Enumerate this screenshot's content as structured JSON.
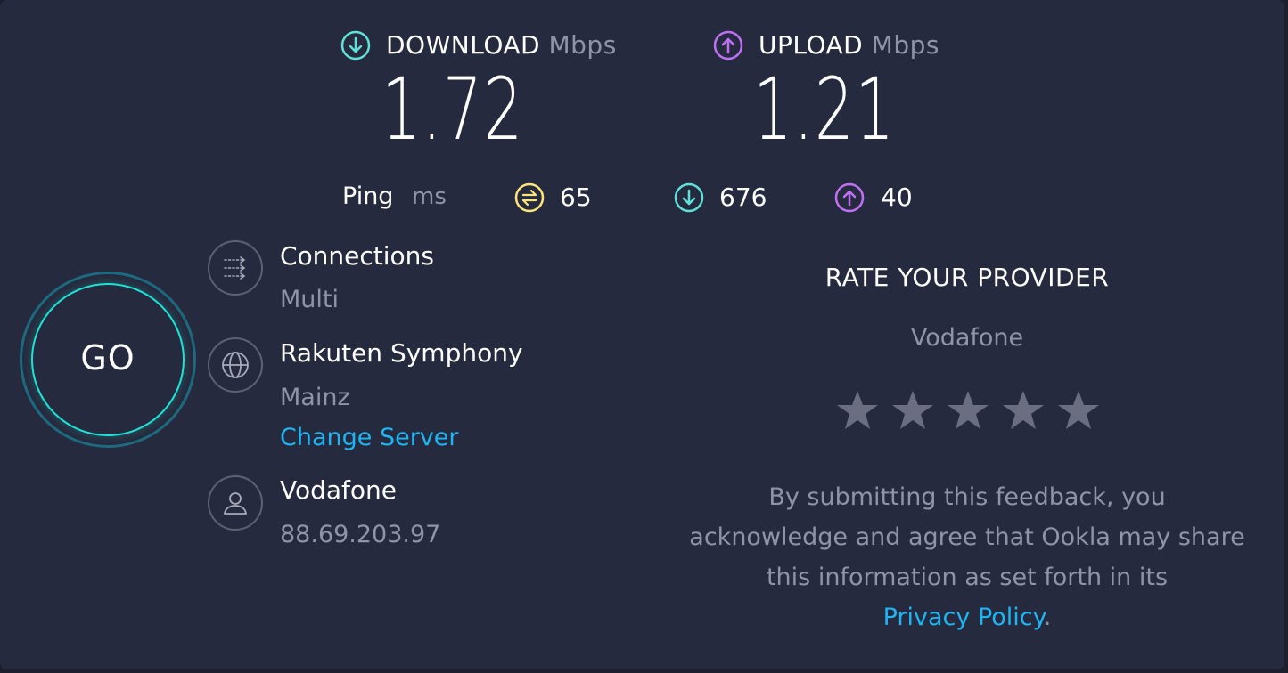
{
  "download": {
    "label": "DOWNLOAD",
    "unit": "Mbps",
    "value": "1.72",
    "icon": "download-arrow-icon",
    "color": "#5fe1d7"
  },
  "upload": {
    "label": "UPLOAD",
    "unit": "Mbps",
    "value": "1.21",
    "icon": "upload-arrow-icon",
    "color": "#bf71f5"
  },
  "ping": {
    "label": "Ping",
    "unit": "ms",
    "idle": {
      "icon": "ping-idle-icon",
      "value": "65",
      "color": "#fbe57a"
    },
    "download": {
      "icon": "ping-download-icon",
      "value": "676",
      "color": "#5fe1d7"
    },
    "upload": {
      "icon": "ping-upload-icon",
      "value": "40",
      "color": "#bf71f5"
    }
  },
  "go_button": {
    "label": "GO"
  },
  "connections": {
    "icon": "connections-icon",
    "title": "Connections",
    "value": "Multi"
  },
  "server": {
    "icon": "globe-icon",
    "title": "Rakuten Symphony",
    "location": "Mainz",
    "change_link": "Change Server"
  },
  "isp": {
    "icon": "user-icon",
    "title": "Vodafone",
    "ip": "88.69.203.97"
  },
  "rate": {
    "title": "RATE YOUR PROVIDER",
    "provider": "Vodafone",
    "stars": 5,
    "feedback_text": "By submitting this feedback, you acknowledge and agree that Ookla may share this information as set forth in its",
    "privacy_link": "Privacy Policy",
    "period": "."
  },
  "colors": {
    "background": "#262a3e",
    "accent_link": "#1fb4f2",
    "muted_text": "#9193a8",
    "star": "#6b6e80"
  }
}
